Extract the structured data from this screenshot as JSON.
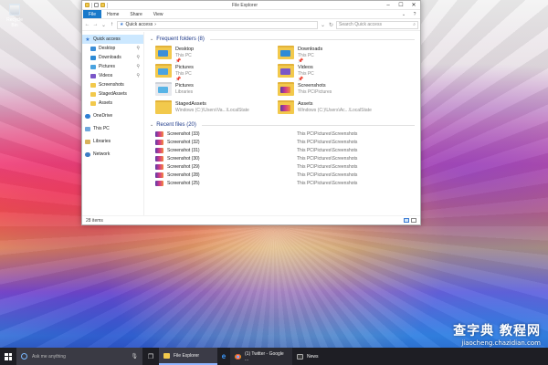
{
  "desktop": {
    "recycle_bin_label": "Recycle Bin"
  },
  "window": {
    "title": "File Explorer",
    "controls": {
      "minimize": "–",
      "maximize": "☐",
      "close": "✕"
    },
    "ribbon_tabs": [
      {
        "label": "File"
      },
      {
        "label": "Home"
      },
      {
        "label": "Share"
      },
      {
        "label": "View"
      }
    ],
    "address": {
      "current": "Quick access",
      "search_placeholder": "Search Quick access"
    },
    "nav": [
      {
        "label": "Quick access"
      },
      {
        "label": "Desktop"
      },
      {
        "label": "Downloads"
      },
      {
        "label": "Pictures"
      },
      {
        "label": "Videos"
      },
      {
        "label": "Screenshots"
      },
      {
        "label": "StagedAssets"
      },
      {
        "label": "Assets"
      },
      {
        "label": "OneDrive"
      },
      {
        "label": "This PC"
      },
      {
        "label": "Libraries"
      },
      {
        "label": "Network"
      }
    ],
    "frequent": {
      "header": "Frequent folders (8)",
      "items": [
        {
          "name": "Desktop",
          "location": "This PC",
          "pinned": "📌"
        },
        {
          "name": "Downloads",
          "location": "This PC",
          "pinned": "📌"
        },
        {
          "name": "Pictures",
          "location": "This PC",
          "pinned": "📌"
        },
        {
          "name": "Videos",
          "location": "This PC",
          "pinned": "📌"
        },
        {
          "name": "Pictures",
          "location": "Libraries",
          "pinned": ""
        },
        {
          "name": "Screenshots",
          "location": "This PC\\Pictures",
          "pinned": ""
        },
        {
          "name": "StagedAssets",
          "location": "Windows (C:)\\Users\\Va...\\LocalState",
          "pinned": ""
        },
        {
          "name": "Assets",
          "location": "Windows (C:)\\Users\\Ac...\\LocalState",
          "pinned": ""
        }
      ]
    },
    "recent": {
      "header": "Recent files (20)",
      "items": [
        {
          "name": "Screenshot (33)",
          "path": "This PC\\Pictures\\Screenshots"
        },
        {
          "name": "Screenshot (32)",
          "path": "This PC\\Pictures\\Screenshots"
        },
        {
          "name": "Screenshot (31)",
          "path": "This PC\\Pictures\\Screenshots"
        },
        {
          "name": "Screenshot (30)",
          "path": "This PC\\Pictures\\Screenshots"
        },
        {
          "name": "Screenshot (29)",
          "path": "This PC\\Pictures\\Screenshots"
        },
        {
          "name": "Screenshot (28)",
          "path": "This PC\\Pictures\\Screenshots"
        },
        {
          "name": "Screenshot (25)",
          "path": "This PC\\Pictures\\Screenshots"
        }
      ]
    },
    "status": {
      "count": "28 items"
    }
  },
  "taskbar": {
    "search_placeholder": "Ask me anything",
    "tasks": [
      {
        "label": "File Explorer"
      },
      {
        "label": "e"
      },
      {
        "label": "(1) Twitter - Google ..."
      },
      {
        "label": "News"
      }
    ]
  },
  "watermark": {
    "big": "查字典 教程网",
    "small": "jiaocheng.chazidian.com"
  },
  "colors": {
    "accent": "#1979ca",
    "selection": "#cce8ff",
    "taskbar": "#1e1e24"
  }
}
